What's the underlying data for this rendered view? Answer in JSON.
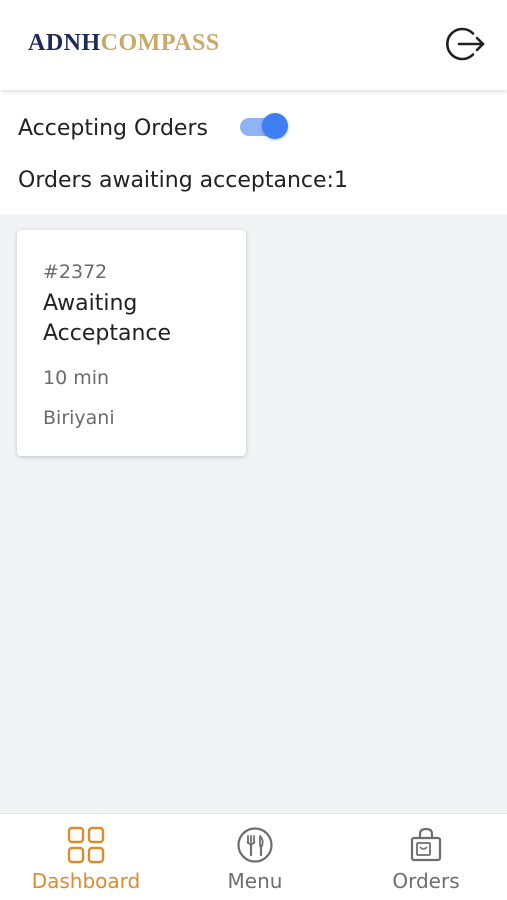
{
  "header": {
    "logo_part1": "ADNH",
    "logo_part2": "COMPASS",
    "logout_icon": "logout-icon"
  },
  "status": {
    "accepting_label": "Accepting Orders",
    "accepting_enabled": true,
    "awaiting_text": "Orders awaiting acceptance:1"
  },
  "orders": [
    {
      "id": "#2372",
      "status": "Awaiting Acceptance",
      "time": "10 min",
      "item": "Biriyani"
    }
  ],
  "bottom_nav": {
    "items": [
      {
        "label": "Dashboard",
        "icon": "dashboard-grid-icon",
        "active": true
      },
      {
        "label": "Menu",
        "icon": "restaurant-menu-icon",
        "active": false
      },
      {
        "label": "Orders",
        "icon": "shopping-bag-icon",
        "active": false
      }
    ]
  },
  "colors": {
    "brand_navy": "#1e2a5a",
    "brand_gold": "#c8a96a",
    "toggle_blue": "#3d7ef2",
    "active_nav": "#e08a2e",
    "inactive_nav": "#6e6e6e",
    "content_bg": "#f2f3f5"
  }
}
